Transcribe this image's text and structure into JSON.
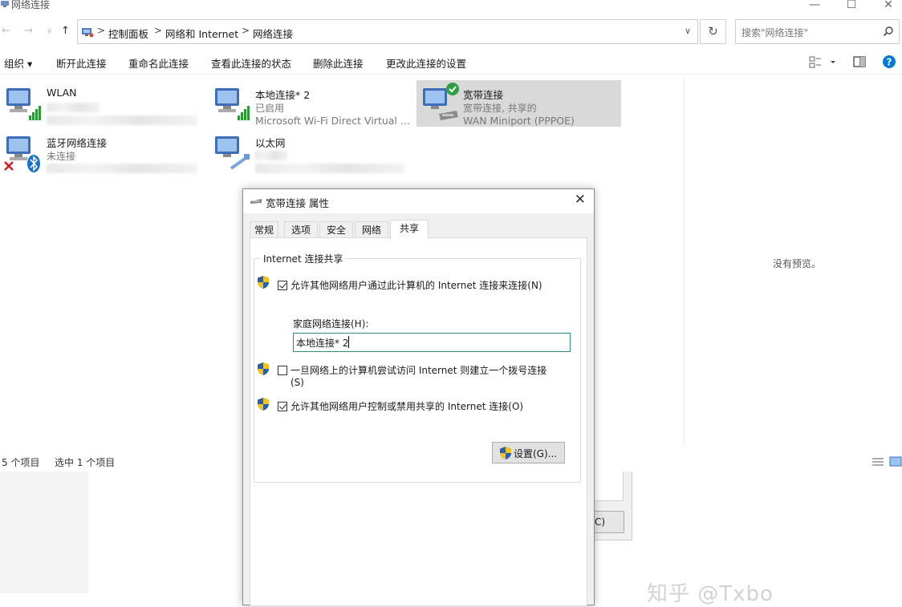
{
  "window": {
    "title": "网络连接",
    "minimize": "—",
    "maximize": "☐",
    "close": "✕"
  },
  "nav": {
    "back": "←",
    "forward": "→",
    "recent": "∨",
    "up": "↑"
  },
  "address": {
    "crumbs": [
      "控制面板",
      "网络和 Internet",
      "网络连接"
    ],
    "separator": ">",
    "dropdown": "∨",
    "refresh": "↻",
    "search_placeholder": "搜索\"网络连接\""
  },
  "commands": [
    "组织 ▾",
    "断开此连接",
    "重命名此连接",
    "查看此连接的状态",
    "删除此连接",
    "更改此连接的设置"
  ],
  "connections": [
    {
      "name": "WLAN",
      "line2": "",
      "line3": ""
    },
    {
      "name": "本地连接* 2",
      "line2": "已启用",
      "line3": "Microsoft Wi-Fi Direct Virtual ..."
    },
    {
      "name": "宽带连接",
      "line2": "宽带连接, 共享的",
      "line3": "WAN Miniport (PPPOE)"
    },
    {
      "name": "蓝牙网络连接",
      "line2": "未连接",
      "line3": ""
    },
    {
      "name": "以太网",
      "line2": "",
      "line3": ""
    }
  ],
  "preview": {
    "text": "没有预览。"
  },
  "status": {
    "count": "5 个项目",
    "selected": "选中 1 个项目"
  },
  "dialog": {
    "title": "宽带连接 属性",
    "close": "✕",
    "tabs": [
      "常规",
      "选项",
      "安全",
      "网络",
      "共享"
    ],
    "active_tab": "共享",
    "group_title": "Internet 连接共享",
    "option1": {
      "label": "允许其他网络用户通过此计算机的 Internet 连接来连接(N)",
      "checked": true
    },
    "home_label": "家庭网络连接(H):",
    "home_value": "本地连接* 2",
    "option2": {
      "label": "一旦网络上的计算机尝试访问 Internet 则建立一个拨号连接",
      "label2": "(S)",
      "checked": false
    },
    "option3": {
      "label": "允许其他网络用户控制或禁用共享的 Internet 连接(O)",
      "checked": true
    },
    "settings_button": "设置(G)..."
  },
  "behind_dialog": {
    "button": "C)"
  },
  "watermark": "知乎 @Txbo",
  "colors": {
    "accent": "#0078d7",
    "selection": "#d9d9d9",
    "select_border": "#2f8a8a"
  }
}
